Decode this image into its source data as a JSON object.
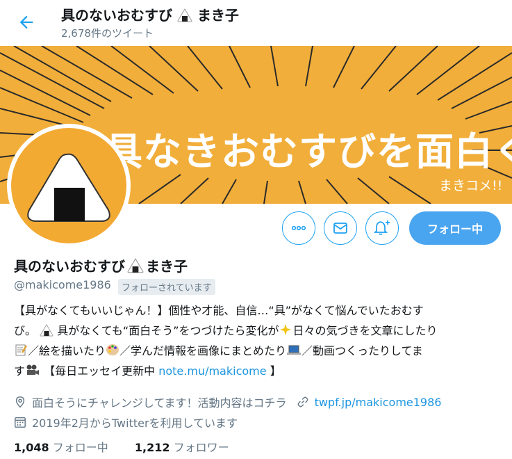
{
  "header": {
    "title": "具のないおむすび",
    "title_suffix": "まき子",
    "tweet_count": "2,678件のツイート"
  },
  "banner": {
    "headline": "具なきおむすびを面白く",
    "signature": "まきコメ!!",
    "color": "#f1ae3a"
  },
  "actions": {
    "more_icon": "more-icon",
    "message_icon": "envelope-icon",
    "notify_icon": "bell-plus-icon",
    "follow_label": "フォロー中"
  },
  "profile": {
    "name": "具のないおむすび",
    "name_suffix": "まき子",
    "handle": "@makicome1986",
    "follows_you": "フォローされています",
    "bio": {
      "line1": "【具がなくてもいいじゃん！】個性や才能、自信…“具”がなくて悩んでいたおむす",
      "line2a": "び。",
      "line2b": "具がなくても“面白そう”をつづけたら変化が",
      "line2c": "日々の気づきを文章にしたり",
      "line3a": "／絵を描いたり",
      "line3b": "／学んだ情報を画像にまとめたり",
      "line3c": "／動画つくったりしてま",
      "line4a": "す",
      "line4b": "【毎日エッセイ更新中",
      "line4_link": "note.mu/makicome",
      "line4c": "】"
    },
    "location": "面白そうにチャレンジしてます！活動内容はコチラ",
    "website": "twpf.jp/makicome1986",
    "joined": "2019年2月からTwitterを利用しています"
  },
  "stats": {
    "following_count": "1,048",
    "following_label": "フォロー中",
    "followers_count": "1,212",
    "followers_label": "フォロワー"
  },
  "colors": {
    "accent": "#1da1f2",
    "muted": "#657786",
    "link": "#1b95e0"
  }
}
